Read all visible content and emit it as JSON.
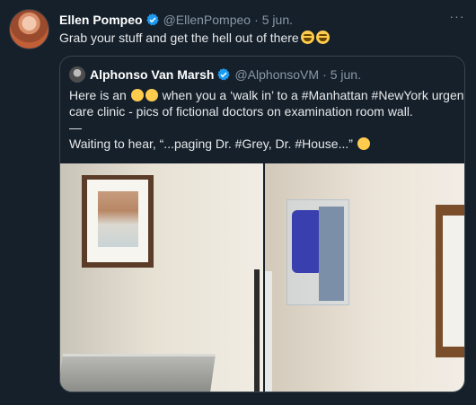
{
  "tweet": {
    "author_name": "Ellen Pompeo",
    "handle": "@EllenPompeo",
    "separator": "·",
    "date": "5 jun.",
    "text": "Grab your stuff and get the hell out of there",
    "more_label": "···"
  },
  "quote": {
    "author_name": "Alphonso Van Marsh",
    "handle": "@AlphonsoVM",
    "separator": "·",
    "date": "5 jun.",
    "line1_a": "Here is an",
    "line1_b": "when you a ‘walk in’ to a #Manhattan #NewYork urgent",
    "line2": "care clinic - pics of fictional doctors on examination room wall.",
    "line3": "—",
    "line4": "Waiting to hear, “...paging Dr. #Grey, Dr. #House...”"
  },
  "colors": {
    "background": "#15202b",
    "text": "#e7e9ea",
    "muted": "#8b98a5",
    "border": "#38444d",
    "verified": "#1d9bf0"
  },
  "icons": [
    "verified-badge-icon",
    "more-options-icon",
    "laughing-emoji",
    "thinking-emoji",
    "cat-emoji"
  ]
}
